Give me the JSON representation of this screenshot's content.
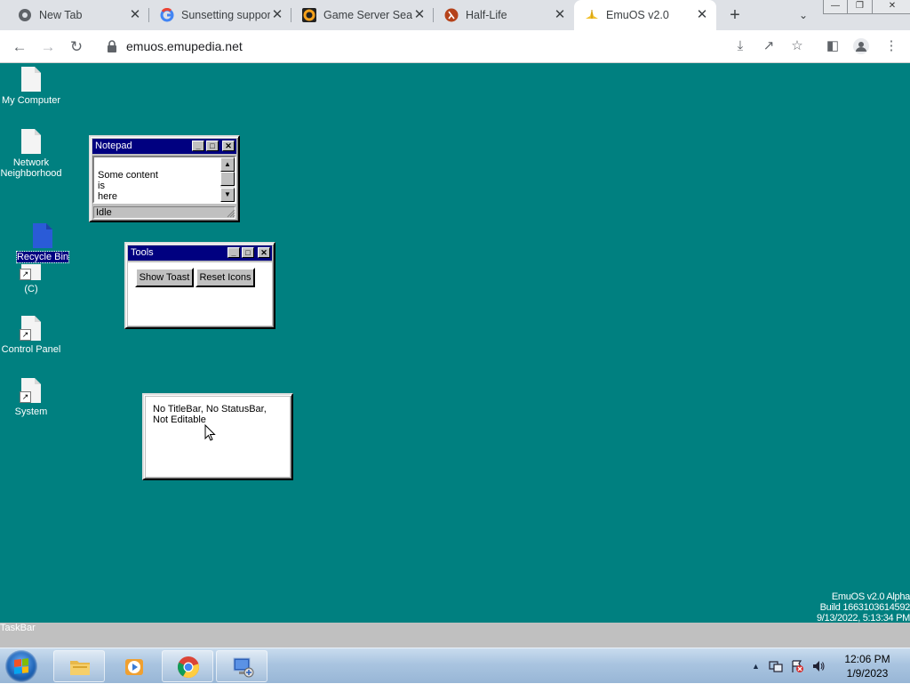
{
  "browser": {
    "tabs": [
      {
        "title": "New Tab",
        "icon": "chrome-icon",
        "active": false
      },
      {
        "title": "Sunsetting support",
        "icon": "google-icon",
        "active": false
      },
      {
        "title": "Game Server Sear",
        "icon": "gametracker-icon",
        "active": false
      },
      {
        "title": "Half-Life",
        "icon": "half-life-icon",
        "active": false
      },
      {
        "title": "EmuOS v2.0",
        "icon": "emuos-icon",
        "active": true
      }
    ],
    "url": "emuos.emupedia.net"
  },
  "desktop": {
    "background": "#008080",
    "icons": [
      {
        "label": "My Computer",
        "shortcut": false,
        "selected": false
      },
      {
        "label": "Network Neighborhood",
        "shortcut": false,
        "selected": false
      },
      {
        "label": "Recycle Bin",
        "shortcut": false,
        "selected": true
      },
      {
        "label": "(C)",
        "shortcut": true,
        "selected": false
      },
      {
        "label": "Control Panel",
        "shortcut": true,
        "selected": false
      },
      {
        "label": "System",
        "shortcut": true,
        "selected": false
      }
    ],
    "build_info": [
      "EmuOS v2.0 Alpha",
      "Build 1663103614592",
      "9/13/2022, 5:13:34 PM"
    ]
  },
  "windows": {
    "notepad": {
      "title": "Notepad",
      "content": "Some content\nis\nhere",
      "status": "Idle"
    },
    "tools": {
      "title": "Tools",
      "buttons": [
        "Show Toast",
        "Reset Icons"
      ]
    },
    "plain": {
      "text": "No TitleBar, No StatusBar, Not Editable"
    }
  },
  "emu_taskbar": {
    "label": "TaskBar"
  },
  "os_taskbar": {
    "apps": [
      "file-explorer-icon",
      "media-player-icon",
      "chrome-icon",
      "remote-desktop-icon"
    ],
    "tray_icons": [
      "show-hidden-icons-icon",
      "network-icon",
      "action-center-icon",
      "volume-icon"
    ],
    "time": "12:06 PM",
    "date": "1/9/2023"
  }
}
